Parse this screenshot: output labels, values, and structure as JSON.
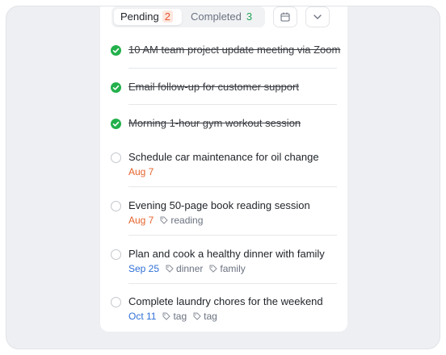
{
  "tabs": {
    "pending_label": "Pending",
    "pending_count": "2",
    "completed_label": "Completed",
    "completed_count": "3"
  },
  "icons": {
    "calendar": "calendar-icon",
    "chevron": "chevron-down-icon",
    "check": "check-circle-icon",
    "circle": "empty-circle-icon",
    "tag": "tag-icon"
  },
  "colors": {
    "done": "#22b04b",
    "date_orange": "#e5642d",
    "date_blue": "#2f6fd6"
  },
  "tasks": [
    {
      "title": "10 AM team project update meeting via Zoom",
      "done": true
    },
    {
      "title": "Email follow-up for customer support",
      "done": true
    },
    {
      "title": "Morning 1-hour gym workout session",
      "done": true
    },
    {
      "title": "Schedule car maintenance for oil change",
      "done": false,
      "date": "Aug 7",
      "tags": []
    },
    {
      "title": "Evening 50-page book reading session",
      "done": false,
      "date": "Aug 7",
      "tags": [
        "reading"
      ]
    },
    {
      "title": "Plan and cook a healthy dinner with family",
      "done": false,
      "date": "Sep 25",
      "tags": [
        "dinner",
        "family"
      ]
    },
    {
      "title": "Complete laundry chores for the weekend",
      "done": false,
      "date": "Oct 11",
      "tags": [
        "tag",
        "tag"
      ]
    }
  ]
}
